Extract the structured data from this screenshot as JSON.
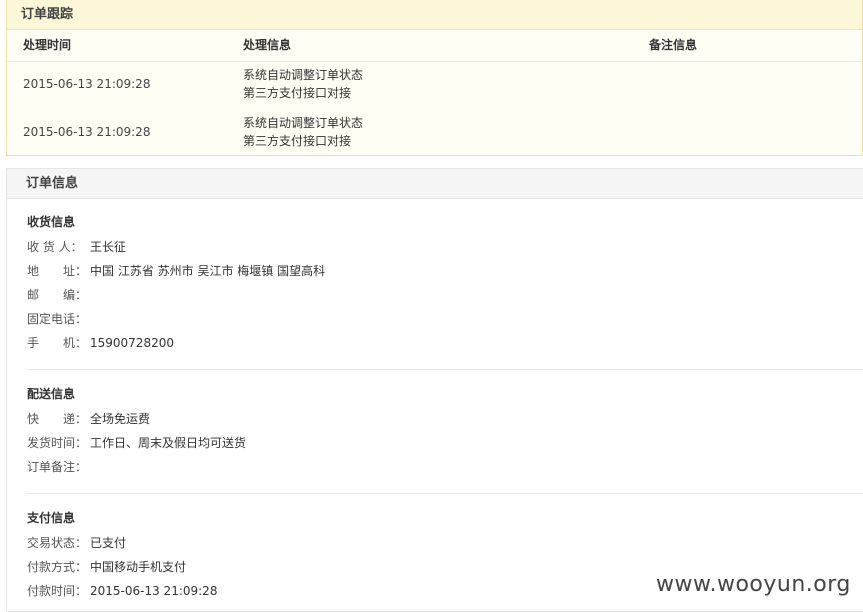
{
  "tracking": {
    "title": "订单跟踪",
    "headers": {
      "time": "处理时间",
      "info": "处理信息",
      "note": "备注信息"
    },
    "rows": [
      {
        "time": "2015-06-13 21:09:28",
        "line1": "系统自动调整订单状态",
        "line2": "第三方支付接口对接",
        "note": ""
      },
      {
        "time": "2015-06-13 21:09:28",
        "line1": "系统自动调整订单状态",
        "line2": "第三方支付接口对接",
        "note": ""
      }
    ]
  },
  "order_info": {
    "title": "订单信息",
    "receiver": {
      "title": "收货信息",
      "name_label": "收 货 人：",
      "name": "王长征",
      "address_label": "地　　址：",
      "address": "中国 江苏省 苏州市 吴江市 梅堰镇 国望高科",
      "zip_label": "邮　　编：",
      "zip": "",
      "phone_label": "固定电话：",
      "phone": "",
      "mobile_label": "手　　机：",
      "mobile": "15900728200"
    },
    "delivery": {
      "title": "配送信息",
      "express_label": "快　　递：",
      "express": "全场免运费",
      "ship_time_label": "发货时间：",
      "ship_time": "工作日、周末及假日均可送货",
      "remark_label": "订单备注：",
      "remark": ""
    },
    "payment": {
      "title": "支付信息",
      "status_label": "交易状态：",
      "status": "已支付",
      "method_label": "付款方式：",
      "method": "中国移动手机支付",
      "time_label": "付款时间：",
      "time": "2015-06-13 21:09:28"
    }
  },
  "watermark": "www.wooyun.org"
}
